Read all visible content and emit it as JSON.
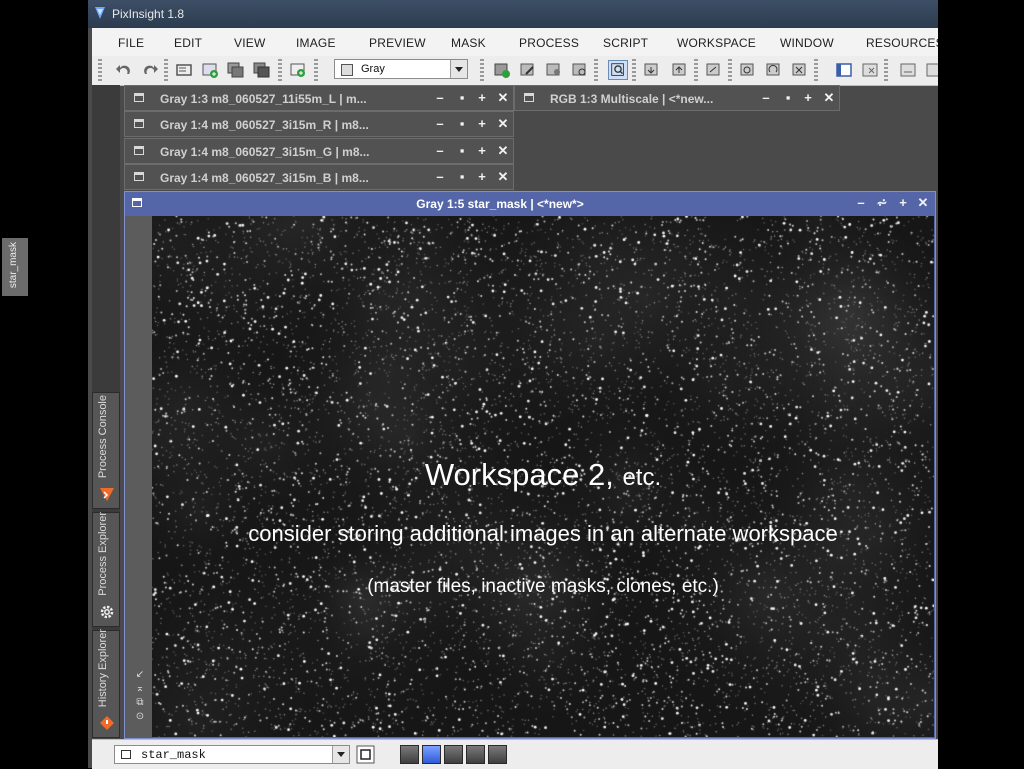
{
  "app": {
    "title": "PixInsight 1.8"
  },
  "menu": [
    "FILE",
    "EDIT",
    "VIEW",
    "IMAGE",
    "PREVIEW",
    "MASK",
    "PROCESS",
    "SCRIPT",
    "WORKSPACE",
    "WINDOW",
    "RESOURCES"
  ],
  "toolbar": {
    "view_combo_value": "Gray"
  },
  "iconified_windows": [
    {
      "title": "Gray 1:3 m8_060527_11i55m_L | m..."
    },
    {
      "title": "Gray 1:4 m8_060527_3i15m_R | m8..."
    },
    {
      "title": "Gray 1:4 m8_060527_3i15m_G | m8..."
    },
    {
      "title": "Gray 1:4 m8_060527_3i15m_B | m8..."
    },
    {
      "title": "RGB 1:3 Multiscale | <*new..."
    }
  ],
  "image_window": {
    "title": "Gray 1:5 star_mask | <*new*>",
    "mask_tab": "star_mask"
  },
  "side_panels": [
    "Process Console",
    "Process Explorer",
    "History Explorer"
  ],
  "overlay": {
    "heading": "Workspace 2,",
    "heading_suffix": "etc.",
    "line1": "consider storing additional images in an alternate workspace",
    "line2": "(master files, inactive masks, clones, etc.)"
  },
  "statusbar": {
    "view_selector": "star_mask",
    "active_workspace": 2
  },
  "colors": {
    "window_active": "#5566a8",
    "titlebar": "#2c3b4f",
    "workspace_active": "#2f5bd8"
  }
}
